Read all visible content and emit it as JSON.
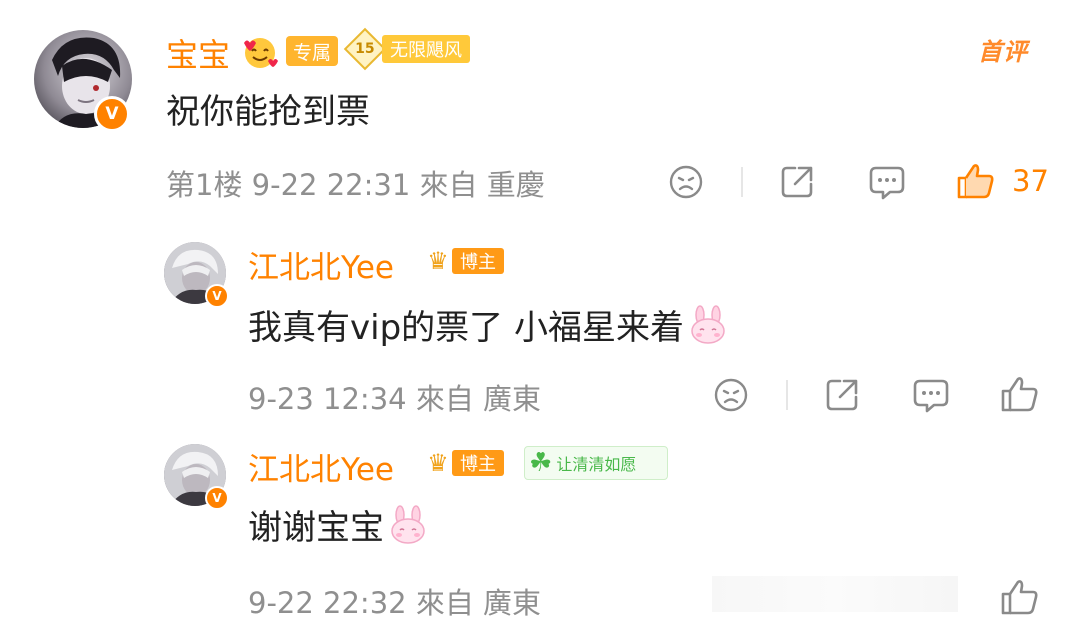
{
  "main_comment": {
    "username": "宝宝",
    "badge_exclusive": "专属",
    "badge_level": "15",
    "badge_text": "无限飓风",
    "first_comment_tag": "首评",
    "text": "祝你能抢到票",
    "meta": "第1楼  9-22 22:31  來自 重慶",
    "like_count": "37"
  },
  "replies": [
    {
      "username": "江北北Yee",
      "badge_blogger": "博主",
      "text": "我真有vip的票了 小福星来着",
      "meta": "9-23 12:34  來自 廣東"
    },
    {
      "username": "江北北Yee",
      "badge_blogger": "博主",
      "badge_extra": "让清清如愿",
      "text": "谢谢宝宝",
      "meta": "9-22 22:32  來自 廣東"
    }
  ],
  "colors": {
    "accent": "#ff8200",
    "meta_gray": "#8f8f8f",
    "icon_gray": "#8a8a8a"
  }
}
